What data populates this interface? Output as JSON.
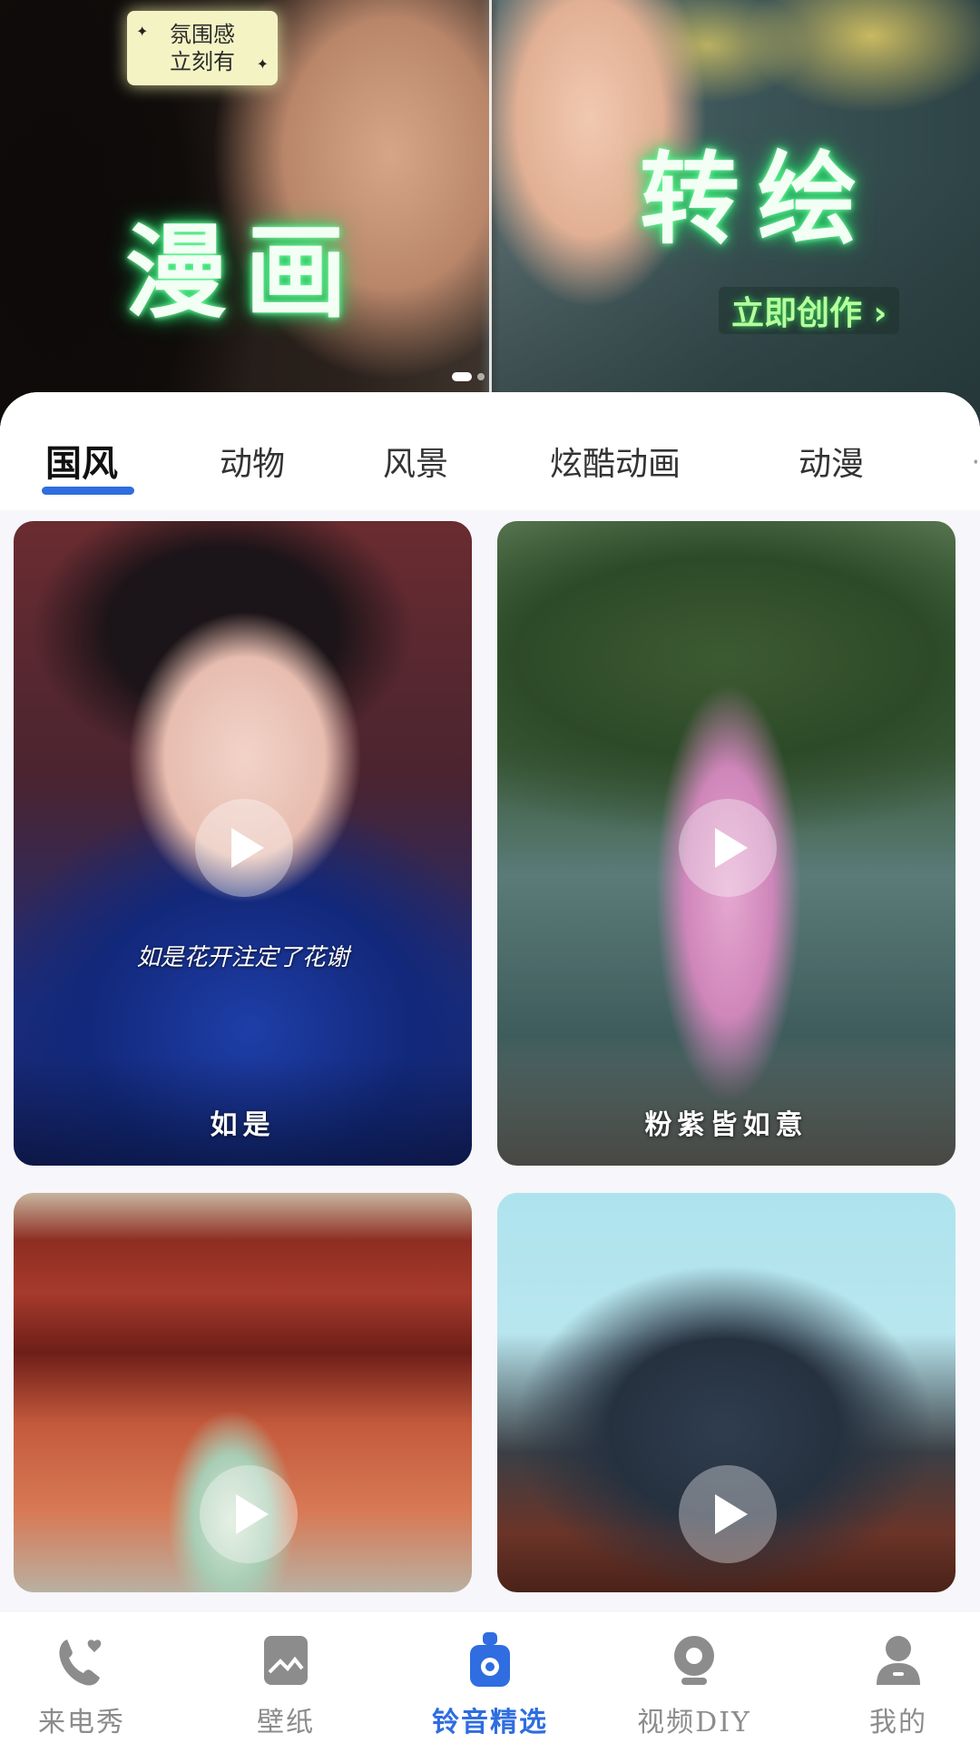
{
  "banner": {
    "badge_line1": "氛围感",
    "badge_line2": "立刻有",
    "badge_sparkle": "✦",
    "headline_left": "漫画",
    "headline_right": "转绘",
    "cta": "立即创作 ›",
    "page_count": 2,
    "active_page": 1
  },
  "tabs": {
    "items": [
      "国风",
      "动物",
      "风景",
      "炫酷动画",
      "动漫"
    ],
    "active": "国风",
    "more_glyph": "·"
  },
  "cards": [
    {
      "title": "如是",
      "subtitle": "如是花开注定了花谢"
    },
    {
      "title": "粉紫皆如意",
      "subtitle": ""
    },
    {
      "title": "",
      "subtitle": ""
    },
    {
      "title": "",
      "subtitle": ""
    }
  ],
  "bottom_nav": {
    "items": [
      {
        "label": "来电秀",
        "icon": "phone-heart-icon"
      },
      {
        "label": "壁纸",
        "icon": "wallpaper-icon"
      },
      {
        "label": "铃音精选",
        "icon": "ringtone-icon"
      },
      {
        "label": "视频DIY",
        "icon": "webcam-icon"
      },
      {
        "label": "我的",
        "icon": "profile-icon"
      }
    ],
    "active_index": 2
  },
  "colors": {
    "accent": "#2f6de0",
    "nav_inactive": "#8c8c8c",
    "neon_green": "#37e57a"
  }
}
